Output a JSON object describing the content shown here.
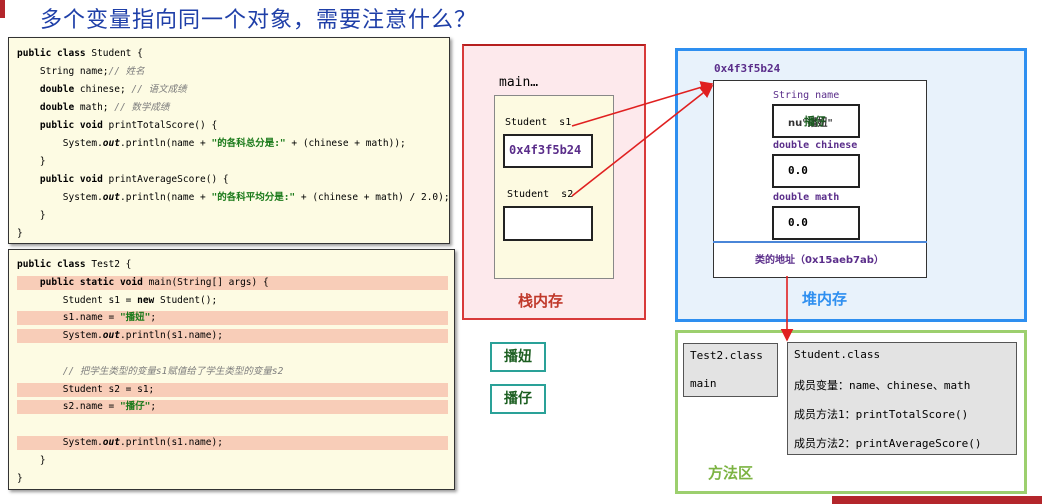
{
  "title": "多个变量指向同一个对象，需要注意什么？",
  "student_code": [
    [
      [
        "kw",
        "public class "
      ],
      [
        "t",
        "Student {"
      ]
    ],
    [
      [
        "t",
        "    String name;"
      ],
      [
        "cm",
        "// 姓名"
      ]
    ],
    [
      [
        "kw",
        "    double "
      ],
      [
        "t",
        "chinese; "
      ],
      [
        "cm",
        "// 语文成绩"
      ]
    ],
    [
      [
        "kw",
        "    double "
      ],
      [
        "t",
        "math; "
      ],
      [
        "cm",
        "// 数学成绩"
      ]
    ],
    [
      [
        "kw",
        "    public void "
      ],
      [
        "t",
        "printTotalScore() {"
      ]
    ],
    [
      [
        "t",
        "        System."
      ],
      [
        "it",
        "out"
      ],
      [
        "t",
        ".println(name + "
      ],
      [
        "st",
        "\"的各科总分是:\""
      ],
      [
        "t",
        " + (chinese + math));"
      ]
    ],
    [
      [
        "t",
        "    }"
      ]
    ],
    [
      [
        "kw",
        "    public void "
      ],
      [
        "t",
        "printAverageScore() {"
      ]
    ],
    [
      [
        "t",
        "        System."
      ],
      [
        "it",
        "out"
      ],
      [
        "t",
        ".println(name + "
      ],
      [
        "st",
        "\"的各科平均分是:\""
      ],
      [
        "t",
        " + (chinese + math) / 2.0);"
      ]
    ],
    [
      [
        "t",
        "    }"
      ]
    ],
    [
      [
        "t",
        "}"
      ]
    ]
  ],
  "test_code": [
    {
      "hl": false,
      "parts": [
        [
          "kw",
          "public class "
        ],
        [
          "t",
          "Test2 {"
        ]
      ]
    },
    {
      "hl": true,
      "parts": [
        [
          "kw",
          "    public static void "
        ],
        [
          "t",
          "main(String[] args) {"
        ]
      ]
    },
    {
      "hl": false,
      "parts": [
        [
          "t",
          "        Student s1 = "
        ],
        [
          "kw",
          "new "
        ],
        [
          "t",
          "Student();"
        ]
      ]
    },
    {
      "hl": true,
      "parts": [
        [
          "t",
          "        s1.name = "
        ],
        [
          "st",
          "\"播妞\""
        ],
        [
          "t",
          ";"
        ]
      ]
    },
    {
      "hl": true,
      "parts": [
        [
          "t",
          "        System."
        ],
        [
          "it",
          "out"
        ],
        [
          "t",
          ".println(s1.name);"
        ]
      ]
    },
    {
      "hl": false,
      "parts": [
        [
          "t",
          ""
        ]
      ]
    },
    {
      "hl": false,
      "parts": [
        [
          "cm",
          "        // 把学生类型的变量s1赋值给了学生类型的变量s2"
        ]
      ]
    },
    {
      "hl": true,
      "parts": [
        [
          "t",
          "        Student s2 = s1;"
        ]
      ]
    },
    {
      "hl": true,
      "parts": [
        [
          "t",
          "        s2.name = "
        ],
        [
          "st",
          "\"播仔\""
        ],
        [
          "t",
          ";"
        ]
      ]
    },
    {
      "hl": false,
      "parts": [
        [
          "t",
          ""
        ]
      ]
    },
    {
      "hl": true,
      "parts": [
        [
          "t",
          "        System."
        ],
        [
          "it",
          "out"
        ],
        [
          "t",
          ".println(s1.name);"
        ]
      ]
    },
    {
      "hl": false,
      "parts": [
        [
          "t",
          "    }"
        ]
      ]
    },
    {
      "hl": false,
      "parts": [
        [
          "t",
          "}"
        ]
      ]
    }
  ],
  "stack": {
    "label": "栈内存",
    "frame_title": "main…",
    "var1_label": "Student  s1",
    "var1_value": "0x4f3f5b24",
    "var2_label": "Student  s2",
    "var2_value": ""
  },
  "heap": {
    "label": "堆内存",
    "address": "0x4f3f5b24",
    "field_name_label": "String name",
    "field_name_value": "nu\"播妞\"",
    "field_name_overlay": "播仔",
    "field_chinese_label": "double chinese",
    "field_chinese_value": "0.0",
    "field_math_label": "double math",
    "field_math_value": "0.0",
    "class_addr": "类的地址（0x15aeb7ab）"
  },
  "method_area": {
    "label": "方法区",
    "test2_class": "Test2.class",
    "test2_main": "main",
    "student_class": "Student.class",
    "members": "成员变量：name、chinese、math",
    "method1": "成员方法1：printTotalScore()",
    "method2": "成员方法2：printAverageScore()"
  },
  "badges": [
    "播妞",
    "播仔"
  ],
  "colors": {
    "title": "#1f3fa8",
    "stack_border": "#d83a3a",
    "heap_border": "#2e8ff0",
    "method_border": "#9ccf6e",
    "arrow": "#e02020",
    "code_bg": "#fdfbe3",
    "highlight": "#f8cdb8"
  }
}
